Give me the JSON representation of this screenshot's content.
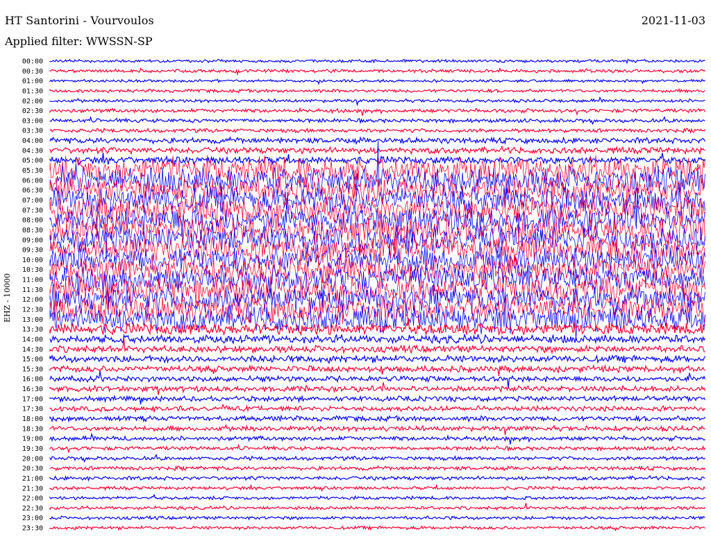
{
  "header": {
    "title": "HT Santorini - Vourvoulos",
    "date": "2021-11-03",
    "filter": "Applied filter: WWSSN-SP"
  },
  "colors": {
    "blue": "#0000ff",
    "red": "#ff0033",
    "background": "#ffffff"
  },
  "chart_data": {
    "type": "line",
    "title": "HT Santorini - Vourvoulos",
    "subtitle": "Applied filter: WWSSN-SP",
    "ylabel": "EHZ - 10000",
    "xlabel": "",
    "row_labels": [
      "00:00",
      "00:30",
      "01:00",
      "01:30",
      "02:00",
      "02:30",
      "03:00",
      "03:30",
      "04:00",
      "04:30",
      "05:00",
      "05:30",
      "06:00",
      "06:30",
      "07:00",
      "07:30",
      "08:00",
      "08:30",
      "09:00",
      "09:30",
      "10:00",
      "10:30",
      "11:00",
      "11:30",
      "12:00",
      "12:30",
      "13:00",
      "13:30",
      "14:00",
      "14:30",
      "15:00",
      "15:30",
      "16:00",
      "16:30",
      "17:00",
      "17:30",
      "18:00",
      "18:30",
      "19:00",
      "19:30",
      "20:00",
      "20:30",
      "21:00",
      "21:30",
      "22:00",
      "22:30",
      "23:00",
      "23:30"
    ],
    "row_colors": [
      "blue",
      "red"
    ],
    "grid": false,
    "legend": "none",
    "activity_level": [
      0.12,
      0.15,
      0.1,
      0.15,
      0.15,
      0.2,
      0.2,
      0.2,
      0.35,
      0.4,
      0.5,
      1.0,
      1.0,
      1.0,
      1.0,
      1.0,
      1.0,
      1.0,
      1.0,
      1.0,
      1.0,
      1.0,
      1.0,
      1.0,
      1.0,
      1.0,
      1.0,
      0.85,
      0.55,
      0.45,
      0.45,
      0.4,
      0.35,
      0.35,
      0.3,
      0.3,
      0.3,
      0.3,
      0.25,
      0.2,
      0.2,
      0.2,
      0.2,
      0.15,
      0.15,
      0.15,
      0.15,
      0.15
    ]
  }
}
